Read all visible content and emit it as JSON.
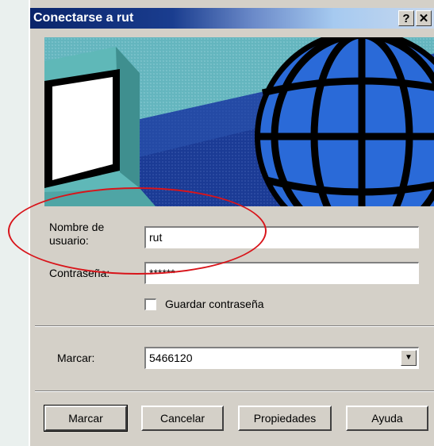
{
  "window": {
    "title": "Conectarse a rut",
    "help_button": "?",
    "close_button": "✕"
  },
  "form": {
    "username_label_line1": "Nombre de",
    "username_label_line2": "usuario:",
    "username_value": "rut",
    "password_label": "Contraseña:",
    "password_value": "******",
    "save_password_label": "Guardar contraseña",
    "save_password_checked": false,
    "dial_label": "Marcar:",
    "dial_value": "5466120"
  },
  "buttons": {
    "dial": "Marcar",
    "cancel": "Cancelar",
    "properties": "Propiedades",
    "help": "Ayuda"
  },
  "colors": {
    "annotation_ring": "#d8141a",
    "titlebar": "#0a246a"
  }
}
